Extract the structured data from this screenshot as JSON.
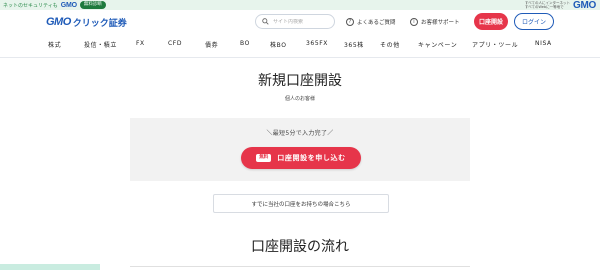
{
  "topbar": {
    "security_text": "ネットのセキュリティも",
    "brand_small": "GMO",
    "pill_label": "無料診断",
    "right_text": "すべての人にインターネット\nすべてのWebに一等地で",
    "brand_large": "GMO"
  },
  "header": {
    "logo_gmo": "GMO",
    "logo_service": "クリック証券",
    "search_placeholder": "サイト内検索",
    "faq_label": "よくあるご質問",
    "support_label": "お客様サポート",
    "open_account_label": "口座開設",
    "login_label": "ログイン"
  },
  "nav": {
    "items": [
      "株式",
      "投信・積立",
      "FX",
      "CFD",
      "債券",
      "BO",
      "株BO",
      "365FX",
      "365株",
      "その他",
      "キャンペーン",
      "アプリ・ツール",
      "NISA"
    ]
  },
  "main": {
    "title": "新規口座開設",
    "subtitle": "個人のお客様",
    "panel_note": "＼最短5分で入力完了／",
    "cta_badge": "無料",
    "cta_label": "口座開設を申し込む",
    "existing_account_link": "すでに当社の口座をお持ちの場合こちら",
    "flow_title": "口座開設の流れ"
  },
  "colors": {
    "accent_red": "#e6354a",
    "brand_blue": "#1f5bb8",
    "topbar_green": "#e7f4ec"
  }
}
